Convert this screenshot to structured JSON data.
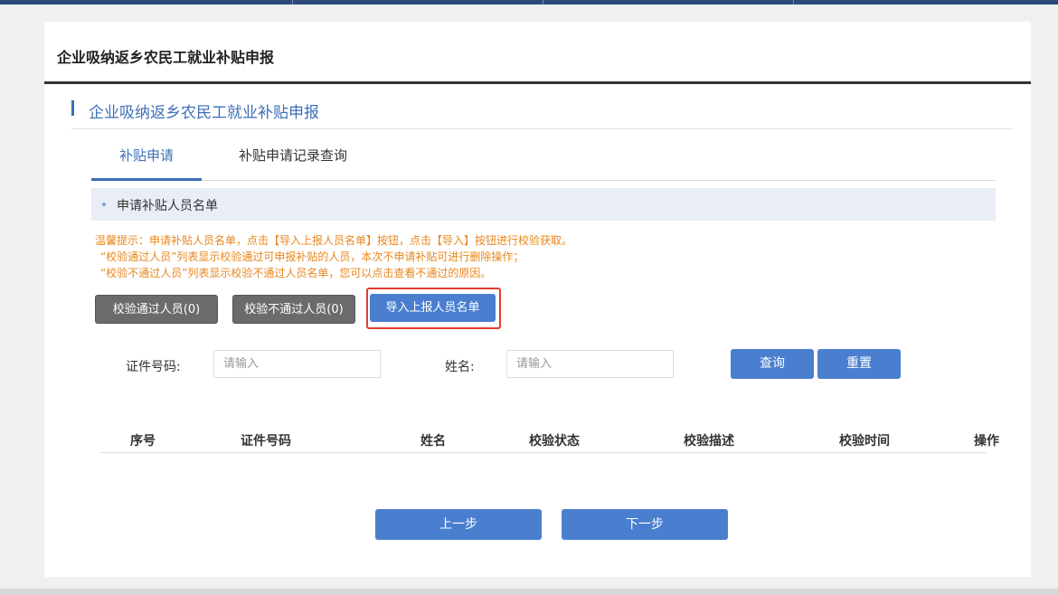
{
  "page": {
    "title": "企业吸纳返乡农民工就业补贴申报",
    "section_title": "企业吸纳返乡农民工就业补贴申报"
  },
  "tabs": [
    {
      "label": "补贴申请",
      "active": true
    },
    {
      "label": "补贴申请记录查询",
      "active": false
    }
  ],
  "subsection": {
    "label": "申请补贴人员名单"
  },
  "tips": [
    "温馨提示：申请补贴人员名单，点击【导入上报人员名单】按钮，点击【导入】按钮进行校验获取。",
    "“校验通过人员”列表显示校验通过可申报补贴的人员，本次不申请补贴可进行删除操作；",
    "“校验不通过人员”列表显示校验不通过人员名单，您可以点击查看不通过的原因。"
  ],
  "action_buttons": {
    "passed": "校验通过人员(0)",
    "failed": "校验不通过人员(0)",
    "import": "导入上报人员名单"
  },
  "search": {
    "id_label": "证件号码:",
    "id_placeholder": "请输入",
    "name_label": "姓名:",
    "name_placeholder": "请输入",
    "query_button": "查询",
    "reset_button": "重置"
  },
  "table": {
    "columns": [
      "序号",
      "证件号码",
      "姓名",
      "校验状态",
      "校验描述",
      "校验时间",
      "操作"
    ],
    "rows": []
  },
  "footer": {
    "prev_button": "上一步",
    "next_button": "下一步"
  },
  "colors": {
    "accent": "#3d6fb7",
    "button_blue": "#4a7fd0",
    "button_gray": "#6b6b6b",
    "tip_orange": "#e8861a",
    "highlight_red": "#e03c31"
  }
}
